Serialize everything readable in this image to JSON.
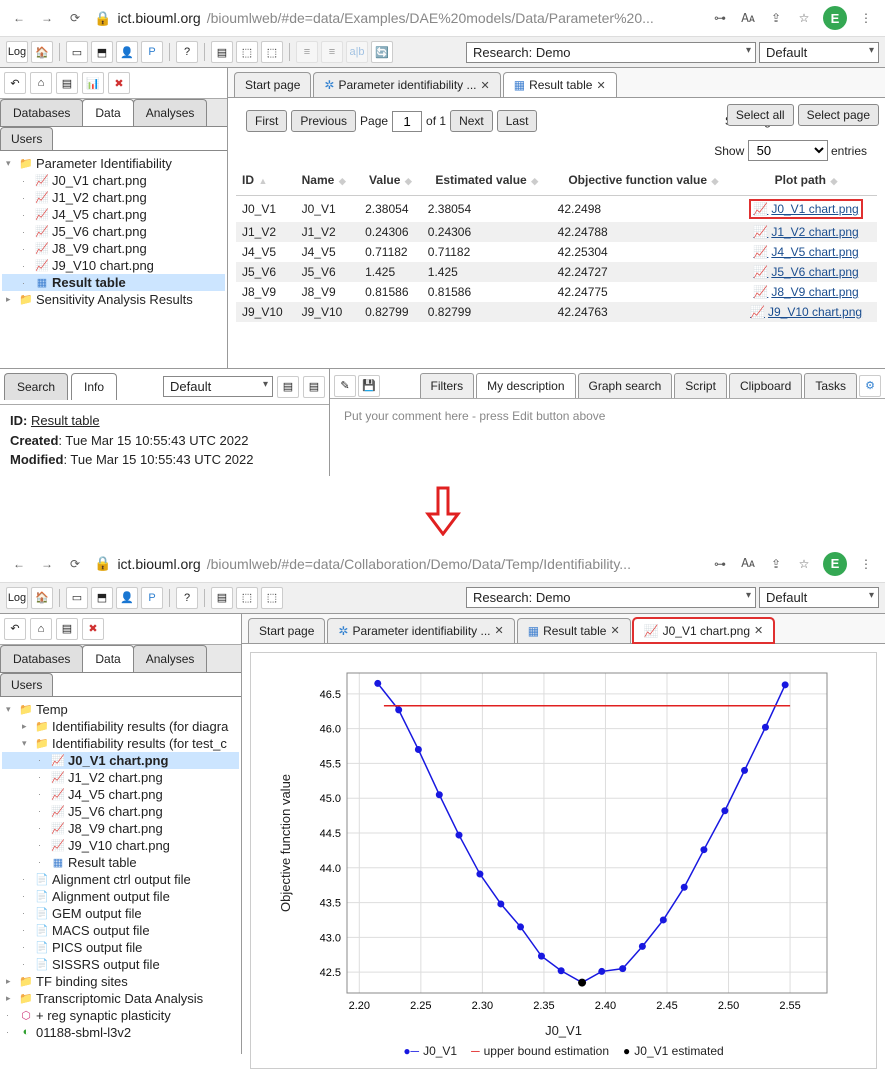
{
  "screen1": {
    "url_host": "ict.biouml.org",
    "url_path": "/bioumlweb/#de=data/Examples/DAE%20models/Data/Parameter%20...",
    "avatar_letter": "E",
    "research_label": "Research: Demo",
    "default_label": "Default",
    "nav_tabs": [
      "Databases",
      "Data",
      "Analyses"
    ],
    "nav_active": "Data",
    "sub_tab": "Users",
    "tree": [
      {
        "label": "Parameter Identifiability",
        "icon": "folder",
        "indent": 0,
        "expanded": true
      },
      {
        "label": "J0_V1 chart.png",
        "icon": "chart",
        "indent": 1
      },
      {
        "label": "J1_V2 chart.png",
        "icon": "chart",
        "indent": 1
      },
      {
        "label": "J4_V5 chart.png",
        "icon": "chart",
        "indent": 1
      },
      {
        "label": "J5_V6 chart.png",
        "icon": "chart",
        "indent": 1
      },
      {
        "label": "J8_V9 chart.png",
        "icon": "chart",
        "indent": 1
      },
      {
        "label": "J9_V10 chart.png",
        "icon": "chart",
        "indent": 1
      },
      {
        "label": "Result table",
        "icon": "table",
        "indent": 1,
        "selected": true
      },
      {
        "label": "Sensitivity Analysis Results",
        "icon": "folder",
        "indent": 0
      }
    ],
    "content_tabs": [
      {
        "label": "Start page",
        "closable": false
      },
      {
        "label": "Parameter identifiability ...",
        "icon": "gear",
        "closable": true
      },
      {
        "label": "Result table",
        "icon": "table",
        "closable": true,
        "active": true
      }
    ],
    "select_all": "Select all",
    "select_page": "Select page",
    "first": "First",
    "previous": "Previous",
    "page_label": "Page",
    "page_value": "1",
    "of_label": "of 1",
    "next": "Next",
    "last": "Last",
    "entries_text": "Showing 1 to 6 of 6 entries",
    "show_label": "Show",
    "show_value": "50",
    "entries_label": "entries",
    "table": {
      "headers": [
        "ID",
        "Name",
        "Value",
        "Estimated value",
        "Objective function value",
        "Plot path"
      ],
      "rows": [
        {
          "id": "J0_V1",
          "name": "J0_V1",
          "value": "2.38054",
          "est": "2.38054",
          "obj": "42.2498",
          "plot": "J0_V1 chart.png",
          "hl": true
        },
        {
          "id": "J1_V2",
          "name": "J1_V2",
          "value": "0.24306",
          "est": "0.24306",
          "obj": "42.24788",
          "plot": "J1_V2 chart.png"
        },
        {
          "id": "J4_V5",
          "name": "J4_V5",
          "value": "0.71182",
          "est": "0.71182",
          "obj": "42.25304",
          "plot": "J4_V5 chart.png"
        },
        {
          "id": "J5_V6",
          "name": "J5_V6",
          "value": "1.425",
          "est": "1.425",
          "obj": "42.24727",
          "plot": "J5_V6 chart.png"
        },
        {
          "id": "J8_V9",
          "name": "J8_V9",
          "value": "0.81586",
          "est": "0.81586",
          "obj": "42.24775",
          "plot": "J8_V9 chart.png"
        },
        {
          "id": "J9_V10",
          "name": "J9_V10",
          "value": "0.82799",
          "est": "0.82799",
          "obj": "42.24763",
          "plot": "J9_V10 chart.png"
        }
      ]
    },
    "info_tabs": [
      "Search",
      "Info"
    ],
    "info_active": "Info",
    "info_default": "Default",
    "info_id_label": "ID:",
    "info_id": "Result table",
    "info_created_label": "Created",
    "info_created": ": Tue Mar 15 10:55:43 UTC 2022",
    "info_modified_label": "Modified",
    "info_modified": ": Tue Mar 15 10:55:43 UTC 2022",
    "desc_tabs": [
      "Filters",
      "My description",
      "Graph search",
      "Script",
      "Clipboard",
      "Tasks"
    ],
    "desc_active": "My description",
    "desc_placeholder": "Put your comment here - press Edit button above"
  },
  "screen2": {
    "url_host": "ict.biouml.org",
    "url_path": "/bioumlweb/#de=data/Collaboration/Demo/Data/Temp/Identifiability...",
    "avatar_letter": "E",
    "research_label": "Research: Demo",
    "default_label": "Default",
    "nav_tabs": [
      "Databases",
      "Data",
      "Analyses"
    ],
    "nav_active": "Data",
    "sub_tab": "Users",
    "tree": [
      {
        "label": "Temp",
        "icon": "folder",
        "indent": 0,
        "expanded": true
      },
      {
        "label": "Identifiability results (for diagra",
        "icon": "folder",
        "indent": 1
      },
      {
        "label": "Identifiability results (for test_c",
        "icon": "folder",
        "indent": 1,
        "expanded": true
      },
      {
        "label": "J0_V1 chart.png",
        "icon": "chart",
        "indent": 2,
        "selected": true
      },
      {
        "label": "J1_V2 chart.png",
        "icon": "chart",
        "indent": 2
      },
      {
        "label": "J4_V5 chart.png",
        "icon": "chart",
        "indent": 2
      },
      {
        "label": "J5_V6 chart.png",
        "icon": "chart",
        "indent": 2
      },
      {
        "label": "J8_V9 chart.png",
        "icon": "chart",
        "indent": 2
      },
      {
        "label": "J9_V10 chart.png",
        "icon": "chart",
        "indent": 2
      },
      {
        "label": "Result table",
        "icon": "table",
        "indent": 2
      },
      {
        "label": "Alignment ctrl output file",
        "icon": "file",
        "indent": 1
      },
      {
        "label": "Alignment output file",
        "icon": "file",
        "indent": 1
      },
      {
        "label": "GEM output file",
        "icon": "file",
        "indent": 1
      },
      {
        "label": "MACS output file",
        "icon": "file",
        "indent": 1
      },
      {
        "label": "PICS output file",
        "icon": "file",
        "indent": 1
      },
      {
        "label": "SISSRS output file",
        "icon": "file",
        "indent": 1
      },
      {
        "label": "TF binding sites",
        "icon": "folder",
        "indent": 0
      },
      {
        "label": "Transcriptomic Data Analysis",
        "icon": "folder",
        "indent": 0
      },
      {
        "label": "+ reg synaptic plasticity",
        "icon": "other",
        "indent": 0
      },
      {
        "label": "01188-sbml-l3v2",
        "icon": "other2",
        "indent": 0
      }
    ],
    "content_tabs": [
      {
        "label": "Start page",
        "closable": false
      },
      {
        "label": "Parameter identifiability ...",
        "icon": "gear",
        "closable": true
      },
      {
        "label": "Result table",
        "icon": "table",
        "closable": true
      },
      {
        "label": "J0_V1 chart.png",
        "icon": "chart",
        "closable": true,
        "active": true,
        "hl": true
      }
    ]
  },
  "chart_data": {
    "type": "line",
    "title": "",
    "xlabel": "J0_V1",
    "ylabel": "Objective function value",
    "xlim": [
      2.19,
      2.58
    ],
    "ylim": [
      42.2,
      46.8
    ],
    "xticks": [
      2.2,
      2.25,
      2.3,
      2.35,
      2.4,
      2.45,
      2.5,
      2.55
    ],
    "yticks": [
      42.5,
      43.0,
      43.5,
      44.0,
      44.5,
      45.0,
      45.5,
      46.0,
      46.5
    ],
    "series": [
      {
        "name": "J0_V1",
        "color": "#1818e0",
        "marker": true,
        "x": [
          2.215,
          2.232,
          2.248,
          2.265,
          2.281,
          2.298,
          2.315,
          2.331,
          2.348,
          2.364,
          2.381,
          2.397,
          2.414,
          2.43,
          2.447,
          2.464,
          2.48,
          2.497,
          2.513,
          2.53,
          2.546
        ],
        "y": [
          46.65,
          46.27,
          45.7,
          45.05,
          44.47,
          43.91,
          43.48,
          43.15,
          42.73,
          42.52,
          42.35,
          42.51,
          42.55,
          42.87,
          43.25,
          43.72,
          44.26,
          44.82,
          45.4,
          46.02,
          46.63
        ]
      },
      {
        "name": "upper bound estimation",
        "color": "#e02020",
        "marker": false,
        "x": [
          2.22,
          2.55
        ],
        "y": [
          46.33,
          46.33
        ]
      }
    ],
    "legend": [
      "J0_V1",
      "upper bound estimation",
      "J0_V1 estimated"
    ],
    "estimated_point": {
      "x": 2.381,
      "y": 42.35,
      "color": "#000"
    }
  }
}
